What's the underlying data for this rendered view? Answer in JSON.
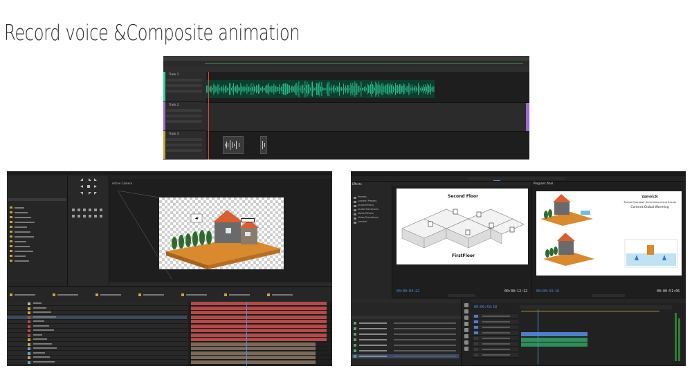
{
  "slide": {
    "title": "Record voice &Composite animation"
  },
  "audition": {
    "tracks": [
      "Track 1",
      "Track 2",
      "Track 3"
    ]
  },
  "aftereffects": {
    "viewer_label": "Active Camera"
  },
  "premiere": {
    "panels": {
      "effects": "Effects",
      "program": "Program: final"
    },
    "source_timecode": "00:00:04:22",
    "source_duration": "00:00:12:12",
    "program_timecode": "00:00:43:16",
    "program_duration": "00:00:51:06",
    "timeline_timecode": "00:00:43:18",
    "effects_folders": [
      "Presets",
      "Lumetri Presets",
      "Audio Effects",
      "Audio Transitions",
      "Video Effects",
      "Video Transitions",
      "Lumetri"
    ],
    "program_text": {
      "week": "Week8",
      "theme": "Theme:Character, Environment and Events",
      "content": "Content:Global Warming"
    },
    "source_text": {
      "second": "Second Floor",
      "first": "FirstFloor"
    }
  },
  "colors": {
    "audition_wave": "#2fd39a",
    "ae_layer_bar": "#b34a4a",
    "premiere_accent": "#4b8fe5",
    "premiere_clip_video": "#4f7fc9",
    "premiere_clip_audio": "#2f8f5a"
  }
}
